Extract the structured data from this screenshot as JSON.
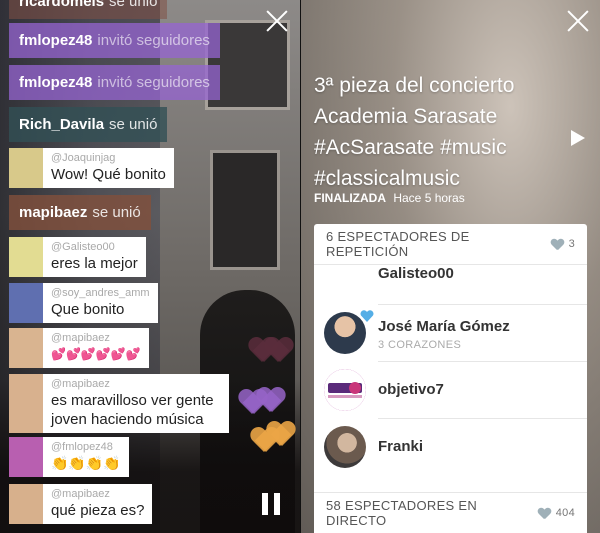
{
  "left": {
    "chat": [
      {
        "type": "event",
        "user": "ricardomeis",
        "action": "se unió"
      },
      {
        "type": "event",
        "user": "fmlopez48",
        "action": "invitó seguidores"
      },
      {
        "type": "event",
        "user": "fmlopez48",
        "action": "invitó seguidores"
      },
      {
        "type": "event",
        "user": "Rich_Davila",
        "action": "se unió"
      },
      {
        "type": "comment",
        "user": "@Joaquinjag",
        "text": "Wow! Qué bonito"
      },
      {
        "type": "event",
        "user": "mapibaez",
        "action": "se unió"
      },
      {
        "type": "comment",
        "user": "@Galisteo00",
        "text": "eres la mejor"
      },
      {
        "type": "comment",
        "user": "@soy_andres_amm",
        "text": "Que bonito"
      },
      {
        "type": "comment",
        "user": "@mapibaez",
        "text": "💕💕💕💕💕💕"
      },
      {
        "type": "comment",
        "user": "@mapibaez",
        "text": "es maravilloso ver gente joven haciendo música"
      },
      {
        "type": "comment",
        "user": "@fmlopez48",
        "text": "👏👏👏👏"
      },
      {
        "type": "comment",
        "user": "@mapibaez",
        "text": "qué pieza es?"
      }
    ]
  },
  "right": {
    "title": "3ª pieza del concierto Academia Sarasate #AcSarasate #music #classicalmusic",
    "status_label": "FINALIZADA",
    "status_time": "Hace 5 horas",
    "replay_label": "6 ESPECTADORES DE REPETICIÓN",
    "replay_hearts": "3",
    "viewers": [
      {
        "name": "Galisteo00",
        "sub": ""
      },
      {
        "name": "José María Gómez",
        "sub": "3 CORAZONES"
      },
      {
        "name": "objetivo7",
        "sub": ""
      },
      {
        "name": "Franki",
        "sub": ""
      }
    ],
    "live_label": "58 ESPECTADORES EN DIRECTO",
    "live_hearts": "404"
  },
  "colors": {
    "chip_purple": "#9664d2",
    "chip_teal": "#32505a",
    "chip_brown": "#82503c",
    "heart_gray": "#9fb0b8",
    "verified_blue": "#55aee6"
  }
}
